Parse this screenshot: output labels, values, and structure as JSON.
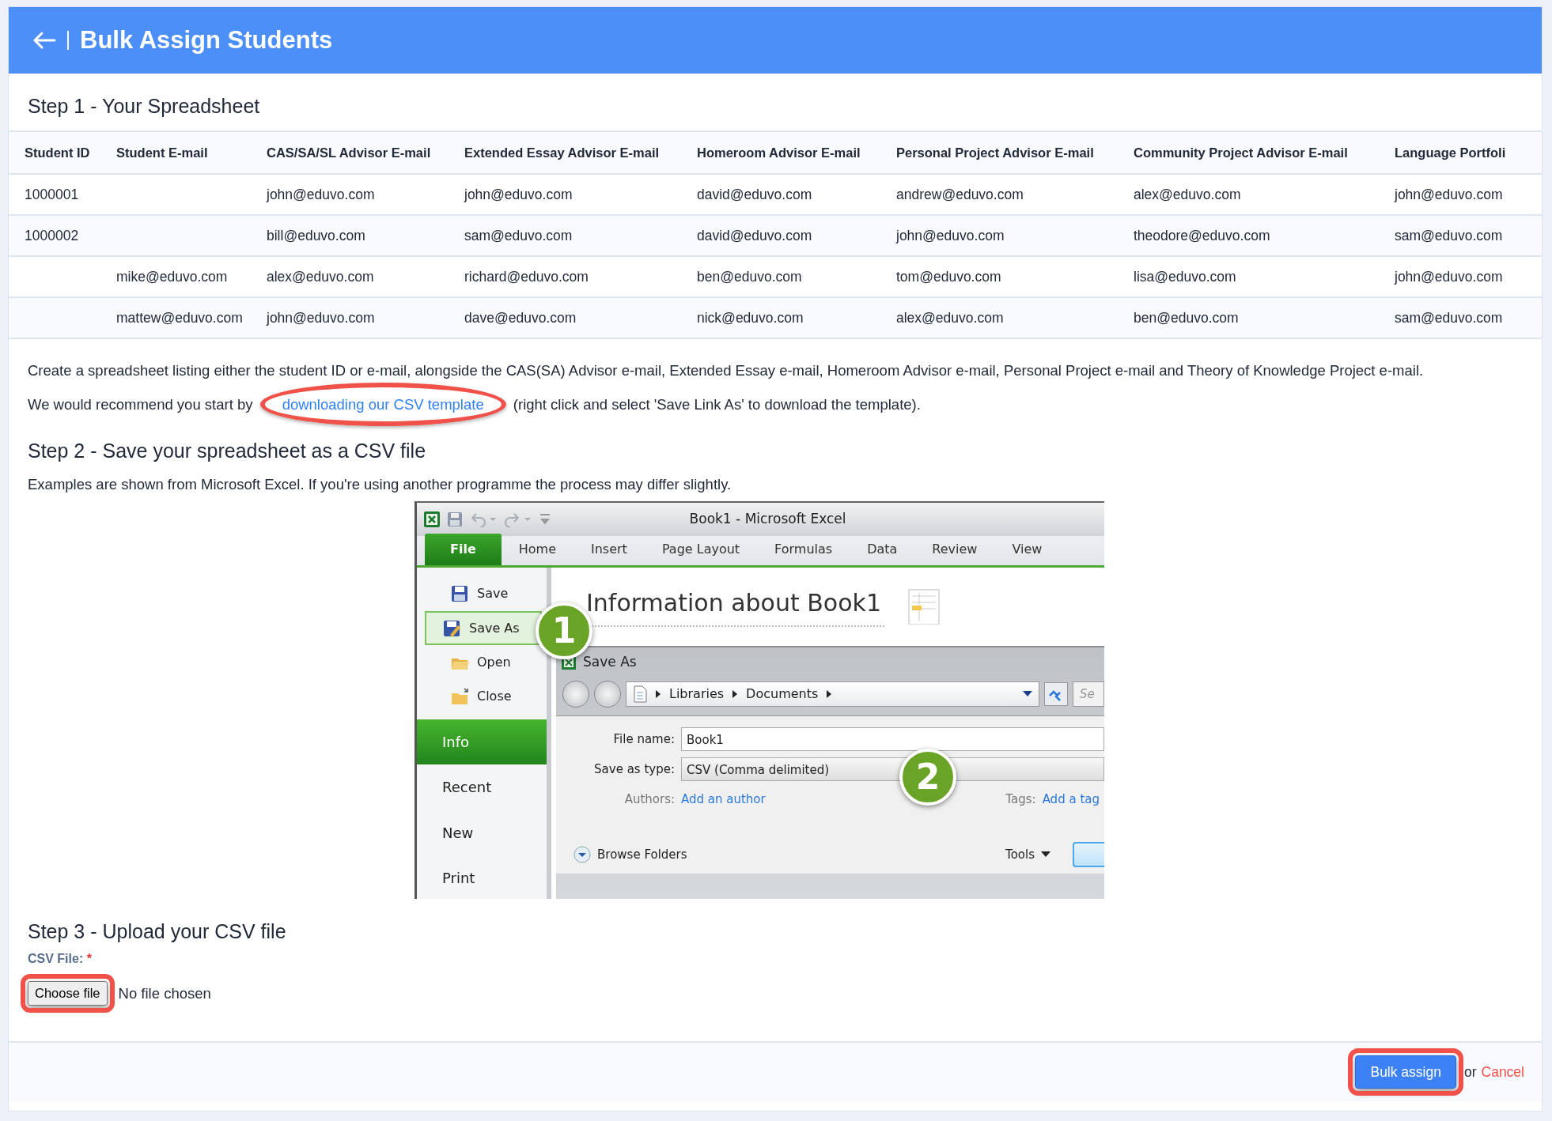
{
  "header": {
    "title": "Bulk Assign Students"
  },
  "step1": {
    "heading": "Step 1 - Your Spreadsheet",
    "table": {
      "columns": [
        "Student ID",
        "Student E-mail",
        "CAS/SA/SL Advisor E-mail",
        "Extended Essay Advisor E-mail",
        "Homeroom Advisor E-mail",
        "Personal Project Advisor E-mail",
        "Community Project Advisor E-mail",
        "Language Portfoli"
      ],
      "rows": [
        [
          "1000001",
          null,
          "john@eduvo.com",
          "john@eduvo.com",
          "david@eduvo.com",
          "andrew@eduvo.com",
          "alex@eduvo.com",
          "john@eduvo.com"
        ],
        [
          "1000002",
          null,
          "bill@eduvo.com",
          "sam@eduvo.com",
          "david@eduvo.com",
          "john@eduvo.com",
          "theodore@eduvo.com",
          "sam@eduvo.com"
        ],
        [
          null,
          "mike@eduvo.com",
          "alex@eduvo.com",
          "richard@eduvo.com",
          "ben@eduvo.com",
          "tom@eduvo.com",
          "lisa@eduvo.com",
          "john@eduvo.com"
        ],
        [
          null,
          "mattew@eduvo.com",
          "john@eduvo.com",
          "dave@eduvo.com",
          "nick@eduvo.com",
          "alex@eduvo.com",
          "ben@eduvo.com",
          "sam@eduvo.com"
        ]
      ]
    },
    "description": "Create a spreadsheet listing either the student ID or e-mail, alongside the CAS(SA) Advisor e-mail, Extended Essay e-mail, Homeroom Advisor e-mail, Personal Project e-mail and Theory of Knowledge Project e-mail.",
    "recommendation": {
      "before": "We would recommend you start by ",
      "link": {
        "text": "downloading our CSV template",
        "highlighted": true
      },
      "after": " (right click and select 'Save Link As' to download the template)."
    }
  },
  "step2": {
    "heading": "Step 2 - Save your spreadsheet as a CSV file",
    "note": "Examples are shown from Microsoft Excel. If you're using another programme the process may differ slightly.",
    "excel": {
      "title": "Book1  -  Microsoft Excel",
      "tabs": [
        {
          "label": "File",
          "selected": true
        },
        {
          "label": "Home",
          "selected": false
        },
        {
          "label": "Insert",
          "selected": false
        },
        {
          "label": "Page Layout",
          "selected": false
        },
        {
          "label": "Formulas",
          "selected": false
        },
        {
          "label": "Data",
          "selected": false
        },
        {
          "label": "Review",
          "selected": false
        },
        {
          "label": "View",
          "selected": false
        }
      ],
      "menu": [
        {
          "label": "Save",
          "kind": "command",
          "selected": false
        },
        {
          "label": "Save As",
          "kind": "command",
          "selected": true
        },
        {
          "label": "Open",
          "kind": "command",
          "selected": false
        },
        {
          "label": "Close",
          "kind": "command",
          "selected": false
        },
        {
          "label": "Info",
          "kind": "page",
          "selected": true
        },
        {
          "label": "Recent",
          "kind": "page",
          "selected": false
        },
        {
          "label": "New",
          "kind": "page",
          "selected": false
        },
        {
          "label": "Print",
          "kind": "page",
          "selected": false
        }
      ],
      "info_heading": "Information about Book1",
      "dialog": {
        "title": "Save As",
        "path": [
          "Libraries",
          "Documents"
        ],
        "search": "Se",
        "fields": [
          {
            "label": "File name:",
            "value": "Book1",
            "kind": "text"
          },
          {
            "label": "Save as type:",
            "value": "CSV (Comma delimited)",
            "kind": "select"
          }
        ],
        "authors_label": "Authors:",
        "authors_link": "Add an author",
        "tags_label": "Tags:",
        "tags_link": "Add a tag",
        "browse": "Browse Folders",
        "tools": "Tools"
      },
      "callouts": [
        "1",
        "2"
      ]
    }
  },
  "step3": {
    "heading": "Step 3 - Upload your CSV file",
    "label": "CSV File:",
    "required": true,
    "required_mark": "*",
    "button": {
      "label": "Choose file",
      "highlighted": true
    },
    "status": "No file chosen"
  },
  "footer": {
    "submit": {
      "label": "Bulk assign",
      "highlighted": true
    },
    "or": "or",
    "cancel": "Cancel"
  }
}
